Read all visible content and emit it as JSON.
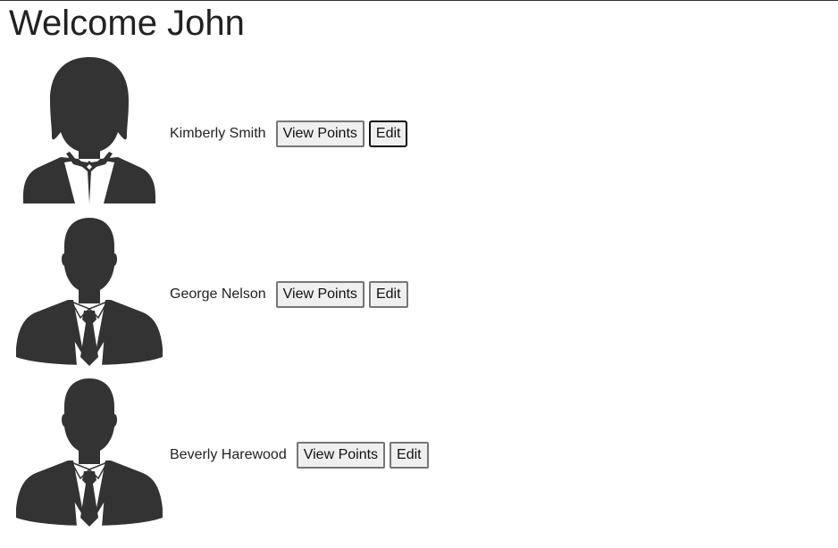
{
  "page": {
    "title": "Welcome John"
  },
  "users": [
    {
      "name": "Kimberly Smith",
      "avatar": "female-avatar-icon",
      "view_label": "View Points",
      "edit_label": "Edit"
    },
    {
      "name": "George Nelson",
      "avatar": "male-avatar-icon",
      "view_label": "View Points",
      "edit_label": "Edit"
    },
    {
      "name": "Beverly Harewood",
      "avatar": "male-avatar-icon",
      "view_label": "View Points",
      "edit_label": "Edit"
    }
  ],
  "colors": {
    "avatar_fill": "#333333",
    "button_bg": "#efefef",
    "button_border": "#767676"
  }
}
